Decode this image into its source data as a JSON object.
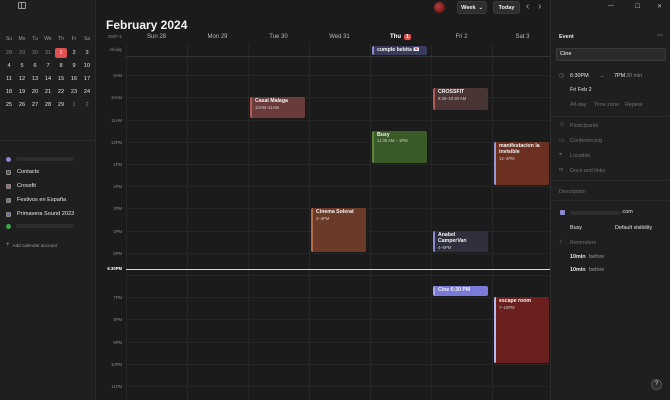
{
  "window": {
    "minimize_icon": "—",
    "maximize_icon": "☐",
    "close_icon": "✕"
  },
  "sidebar": {
    "collapse_icon": "sidebar-toggle-icon",
    "mini_calendar": {
      "weekdays": [
        "Su",
        "Mo",
        "Tu",
        "We",
        "Th",
        "Fr",
        "Sa"
      ],
      "weeks": [
        [
          "28",
          "29",
          "30",
          "31",
          "1",
          "2",
          "3"
        ],
        [
          "4",
          "5",
          "6",
          "7",
          "8",
          "9",
          "10"
        ],
        [
          "11",
          "12",
          "13",
          "14",
          "15",
          "16",
          "17"
        ],
        [
          "18",
          "19",
          "20",
          "21",
          "22",
          "23",
          "24"
        ],
        [
          "25",
          "26",
          "27",
          "28",
          "29",
          "1",
          "2"
        ]
      ],
      "today": "1"
    },
    "calendars": [
      {
        "label": "Contacts",
        "color": "#7a4b4b"
      },
      {
        "label": "Crossfit",
        "color": "#c05a5a"
      },
      {
        "label": "Festivos en España",
        "color": "#8a6a6a"
      },
      {
        "label": "Primavera Sound 2023",
        "color": "#6a6ad0"
      }
    ],
    "add_account": "Add calendar account"
  },
  "header": {
    "month": "February 2024",
    "view_button": "Week",
    "view_caret": "⌄",
    "today_button": "Today",
    "prev": "‹",
    "next": "›",
    "utc_label": "GMT+1",
    "allday_label": "All-day",
    "days": [
      {
        "label": "Sun 28"
      },
      {
        "label": "Mon 29"
      },
      {
        "label": "Tue 30"
      },
      {
        "label": "Wed 31"
      },
      {
        "label": "Thu",
        "badge": "1",
        "today": true
      },
      {
        "label": "Fri 2"
      },
      {
        "label": "Sat 3"
      }
    ]
  },
  "grid": {
    "hours": [
      "9AM",
      "10AM",
      "11AM",
      "12PM",
      "1PM",
      "2PM",
      "3PM",
      "4PM",
      "5PM",
      "",
      "7PM",
      "8PM",
      "9PM",
      "10PM",
      "11PM"
    ],
    "now_label": "6:30PM",
    "allday_events": [
      {
        "title": "cumple bebita 💌",
        "day": 4
      }
    ],
    "events": [
      {
        "title": "Casal Malaga",
        "time": "10AM–11AM",
        "day": 2,
        "start": 10.0,
        "end": 11.0,
        "color": "#6b3a3a",
        "border": "#b75a5a"
      },
      {
        "title": "CROSSFIT",
        "time": "9:30–10:30 AM",
        "day": 5,
        "start": 9.6,
        "end": 10.6,
        "color": "#4a3535",
        "border": "#b75a5a"
      },
      {
        "title": "Busy",
        "time": "11:30 AM – 1PM",
        "day": 4,
        "start": 11.5,
        "end": 13.0,
        "color": "#3a5a28",
        "border": "#5a8a3a"
      },
      {
        "title": "manifestacion la invisible",
        "time": "12–2PM",
        "day": 6,
        "start": 12.0,
        "end": 14.0,
        "color": "#6b3020",
        "border": "#9a9ad8"
      },
      {
        "title": "Cinema Solerat",
        "time": "3–4PM",
        "day": 3,
        "start": 15.0,
        "end": 17.0,
        "color": "#6b3a28",
        "border": "#b56a4a"
      },
      {
        "title": "Anabel CamperVan",
        "time": "4–5PM",
        "day": 5,
        "start": 16.0,
        "end": 17.0,
        "color": "#2f2f3d",
        "border": "#8a8ad0"
      },
      {
        "title": "Cine 6:30 PM",
        "time": "",
        "day": 5,
        "start": 18.5,
        "end": 19.0,
        "color": "#7a7ad8",
        "border": "#a8a8f0"
      },
      {
        "title": "escape room",
        "time": "7–10PM",
        "day": 6,
        "start": 19.0,
        "end": 22.0,
        "color": "#6b1f1f",
        "border": "#b8b8f0"
      }
    ]
  },
  "panel": {
    "header": "Event",
    "more_icon": "⋯",
    "title_value": "Cine",
    "start_time": "6:30PM",
    "arrow": "→",
    "end_time": "7PM",
    "duration": "30 min",
    "date": "Fri Feb 2",
    "options": [
      "All-day",
      "Time zone",
      "Repeat"
    ],
    "participants": "Participants",
    "conferencing": "Conferencing",
    "location": "Location",
    "docs": "Docs and links",
    "description": "Description",
    "account_suffix": ".com",
    "busy": "Busy",
    "visibility": "Default visibility",
    "reminders": "Reminders",
    "reminder_items": [
      {
        "value": "10min",
        "unit": "before"
      },
      {
        "value": "10min",
        "unit": "before"
      }
    ],
    "help": "?"
  }
}
